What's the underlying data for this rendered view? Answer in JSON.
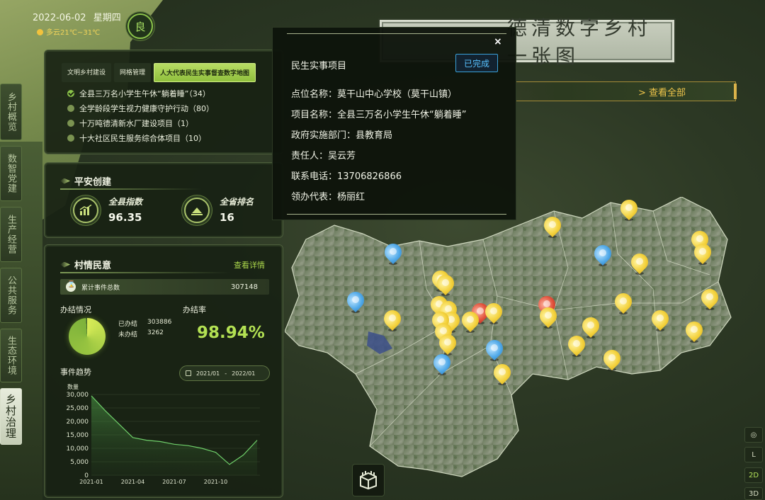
{
  "header": {
    "date": "2022-06-02",
    "weekday": "星期四",
    "weather": "多云21℃~31℃",
    "aqi": "良",
    "title": "德清数字乡村一张图"
  },
  "nav": [
    {
      "label": "乡村概览",
      "active": false
    },
    {
      "label": "数智党建",
      "active": false
    },
    {
      "label": "生产经营",
      "active": false
    },
    {
      "label": "公共服务",
      "active": false
    },
    {
      "label": "生态环境",
      "active": false
    },
    {
      "label": "乡村治理",
      "active": true
    }
  ],
  "panel_projects": {
    "tabs": [
      {
        "label": "文明乡村建设",
        "active": false
      },
      {
        "label": "网格管理",
        "active": false
      },
      {
        "label": "人大代表民生实事督查数字地图",
        "active": true
      }
    ],
    "items": [
      {
        "label": "全县三万名小学生午休“躺着睡”（34）",
        "checked": true
      },
      {
        "label": "全学龄段学生视力健康守护行动（80）",
        "checked": false
      },
      {
        "label": "十万吨德清新水厂建设项目（1）",
        "checked": false
      },
      {
        "label": "十大社区民生服务综合体项目（10）",
        "checked": false
      }
    ]
  },
  "panel_safety": {
    "title": "平安创建",
    "index_label": "全县指数",
    "index_value": "96.35",
    "rank_label": "全省排名",
    "rank_value": "16"
  },
  "panel_village": {
    "title": "村情民意",
    "detail_link": "查看详情",
    "total_label": "累计事件总数",
    "total_value": "307148",
    "handling_title": "办结情况",
    "done_label": "已办结",
    "done_value": "303886",
    "undone_label": "未办结",
    "undone_value": "3262",
    "rate_title": "办结率",
    "rate_value": "98.94%",
    "done_fraction": 0.9894,
    "trend_title": "事件趋势",
    "range_start": "2021/01",
    "range_sep": "-",
    "range_end": "2022/01"
  },
  "chart_data": {
    "type": "area",
    "ylabel": "数量",
    "ylim": [
      0,
      30000
    ],
    "yticks": [
      "30,000",
      "25,000",
      "20,000",
      "15,000",
      "10,000",
      "5,000",
      "0"
    ],
    "xticks": [
      "2021-01",
      "2021-04",
      "2021-07",
      "2021-10"
    ],
    "x": [
      "2021-01",
      "2021-02",
      "2021-03",
      "2021-04",
      "2021-05",
      "2021-06",
      "2021-07",
      "2021-08",
      "2021-09",
      "2021-10",
      "2021-11",
      "2021-12",
      "2022-01"
    ],
    "values": [
      29500,
      24000,
      19000,
      14000,
      13000,
      12500,
      11500,
      11000,
      10000,
      8500,
      4000,
      7500,
      13000
    ]
  },
  "popup": {
    "close": "×",
    "title": "民生实事项目",
    "status": "已完成",
    "rows": [
      "点位名称：莫干山中心学校（莫干山镇）",
      "项目名称：全县三万名小学生午休“躺着睡”",
      "政府实施部门：县教育局",
      "责任人：吴云芳",
      "联系电话：13706826866",
      "领办代表：杨丽红"
    ]
  },
  "view_all": "> 查看全部",
  "map_controls": {
    "l": "L",
    "2d": "2D",
    "3d": "3D"
  },
  "colors": {
    "accent": "#b3e153",
    "gold": "#f0c64b",
    "pin_yellow": "#f3d13b",
    "pin_blue": "#4fa8e8",
    "pin_red": "#e0503a"
  }
}
